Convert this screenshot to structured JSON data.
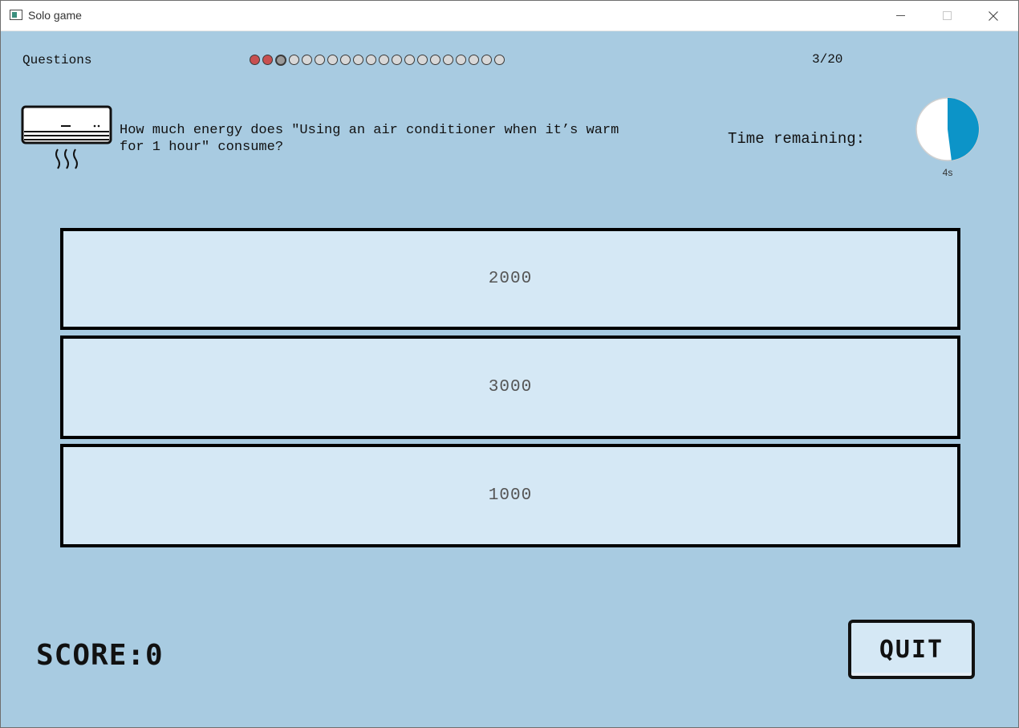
{
  "window": {
    "title": "Solo game"
  },
  "header": {
    "questions_label": "Questions",
    "progress": [
      "wrong",
      "wrong",
      "current",
      "pending",
      "pending",
      "pending",
      "pending",
      "pending",
      "pending",
      "pending",
      "pending",
      "pending",
      "pending",
      "pending",
      "pending",
      "pending",
      "pending",
      "pending",
      "pending",
      "pending"
    ],
    "counter": "3/20"
  },
  "question": {
    "icon": "air-conditioner-icon",
    "text": "How much energy does \"Using an air conditioner when it’s warm\nfor 1 hour\" consume?"
  },
  "timer": {
    "label": "Time remaining:",
    "remaining_text": "4s",
    "remaining_fraction": 0.48
  },
  "answers": [
    {
      "label": "2000"
    },
    {
      "label": "3000"
    },
    {
      "label": "1000"
    }
  ],
  "score": {
    "text": "SCORE:0"
  },
  "quit": {
    "label": "QUIT"
  },
  "colors": {
    "background": "#a8cbe1",
    "answer_fill": "#d5e8f5",
    "timer_fill": "#0c94c8",
    "wrong_dot": "#c85050"
  }
}
